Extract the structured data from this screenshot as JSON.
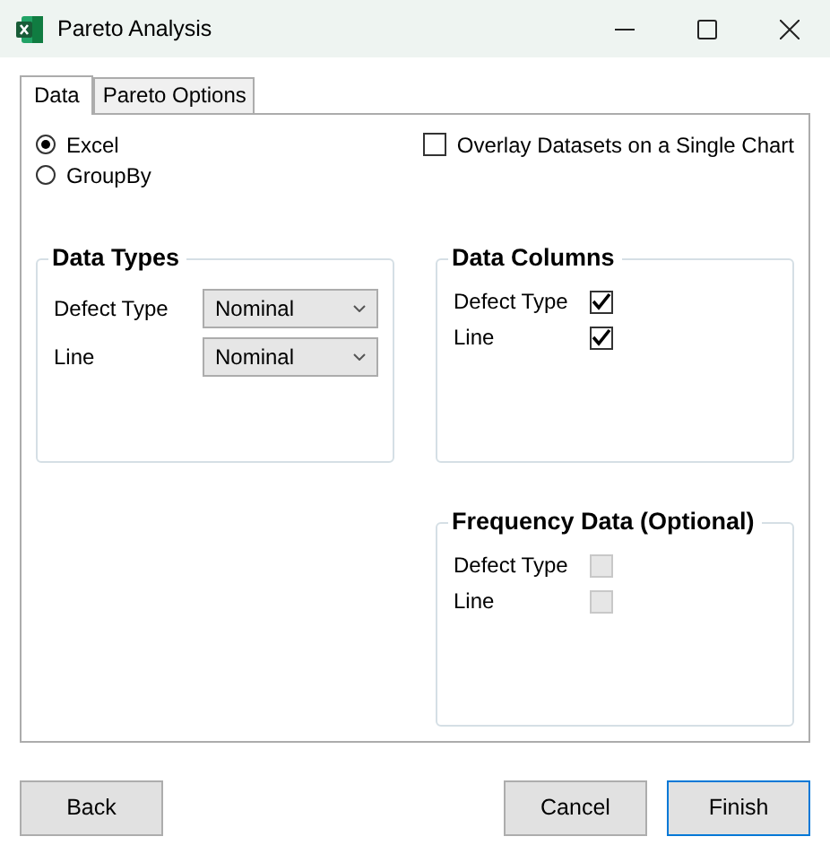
{
  "window": {
    "title": "Pareto Analysis"
  },
  "tabs": [
    {
      "label": "Data",
      "selected": true
    },
    {
      "label": "Pareto Options",
      "selected": false
    }
  ],
  "source": [
    {
      "label": "Excel",
      "selected": true
    },
    {
      "label": "GroupBy",
      "selected": false
    }
  ],
  "overlay": {
    "label": "Overlay Datasets on a Single Chart",
    "checked": false
  },
  "data_types": {
    "title": "Data Types",
    "rows": [
      {
        "label": "Defect Type",
        "value": "Nominal"
      },
      {
        "label": "Line",
        "value": "Nominal"
      }
    ]
  },
  "data_columns": {
    "title": "Data Columns",
    "rows": [
      {
        "label": "Defect Type",
        "checked": true
      },
      {
        "label": "Line",
        "checked": true
      }
    ]
  },
  "frequency_data": {
    "title": "Frequency Data (Optional)",
    "rows": [
      {
        "label": "Defect Type",
        "checked": false,
        "disabled": true
      },
      {
        "label": "Line",
        "checked": false,
        "disabled": true
      }
    ]
  },
  "buttons": [
    {
      "label": "Back",
      "default": false
    },
    {
      "label": "Cancel",
      "default": false
    },
    {
      "label": "Finish",
      "default": true
    }
  ]
}
